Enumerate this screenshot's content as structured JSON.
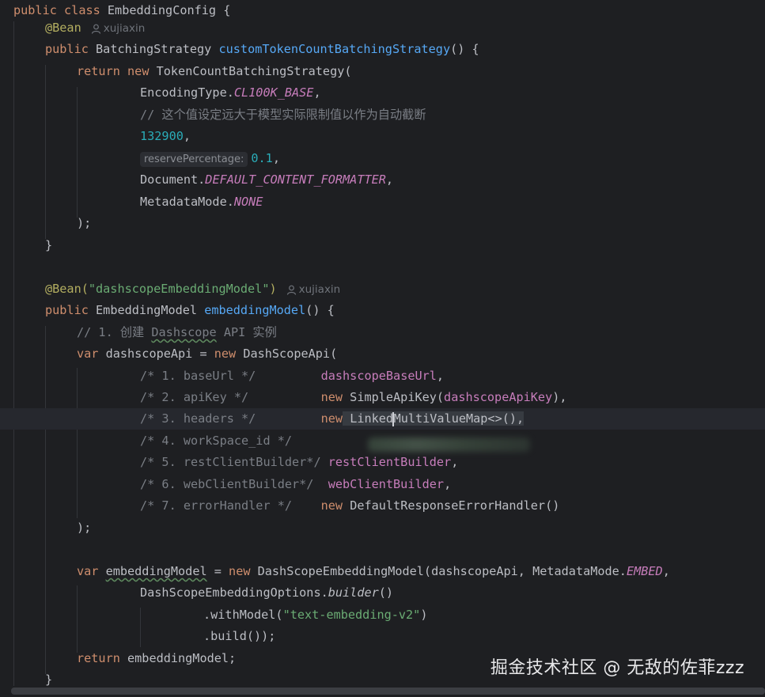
{
  "code": {
    "class_decl": {
      "kw_public": "public",
      "kw_class": "class",
      "name": "EmbeddingConfig",
      "brace": " {"
    },
    "bean1": {
      "annotation": "@Bean",
      "author": "xujiaxin"
    },
    "method1": {
      "kw_public": "public",
      "ret_type": "BatchingStrategy",
      "name": "customTokenCountBatchingStrategy",
      "tail": "() {",
      "kw_return": "return",
      "kw_new": "new",
      "ctor": "TokenCountBatchingStrategy(",
      "arg1_type": "EncodingType.",
      "arg1_const": "CL100K_BASE",
      "arg1_tail": ",",
      "comment": "// 这个值设定远大于模型实际限制值以作为自动截断",
      "arg2_num": "132900",
      "arg2_tail": ",",
      "hint_label": "reservePercentage:",
      "arg3_num": "0.1",
      "arg3_tail": ",",
      "arg4_type": "Document.",
      "arg4_const": "DEFAULT_CONTENT_FORMATTER",
      "arg4_tail": ",",
      "arg5_type": "MetadataMode.",
      "arg5_const": "NONE",
      "close_paren": ");",
      "close_brace": "}"
    },
    "bean2": {
      "annotation": "@Bean(",
      "value": "\"dashscopeEmbeddingModel\"",
      "annotation_tail": ")",
      "author": "xujiaxin"
    },
    "method2": {
      "kw_public": "public",
      "ret_type": "EmbeddingModel",
      "name": "embeddingModel",
      "tail": "() {",
      "comment_pre": "// 1. 创建 ",
      "comment_typo": "Dashscope",
      "comment_post": " API 实例",
      "kw_var": "var",
      "api_var": "dashscopeApi = ",
      "kw_new": "new",
      "api_ctor": "DashScopeApi(",
      "args": [
        {
          "comment": "/* 1. baseUrl */",
          "pad": "         ",
          "kw": "",
          "value": "",
          "field": "dashscopeBaseUrl",
          "tail": ","
        },
        {
          "comment": "/* 2. apiKey */",
          "pad": "          ",
          "kw": "new",
          "value": " SimpleApiKey(",
          "field": "dashscopeApiKey",
          "tail": "),"
        },
        {
          "comment": "/* 3. headers */",
          "pad": "         ",
          "kw": "new",
          "value": " LinkedMultiValueMap<>(),",
          "field": "",
          "tail": ""
        },
        {
          "comment": "/* 4. workSpace_id */",
          "pad": "",
          "kw": "",
          "value": "",
          "field": "",
          "tail": ""
        },
        {
          "comment": "/* 5. restClientBuilder*/",
          "pad": " ",
          "kw": "",
          "value": "",
          "field": "restClientBuilder",
          "tail": ","
        },
        {
          "comment": "/* 6. webClientBuilder*/",
          "pad": "  ",
          "kw": "",
          "value": "",
          "field": "webClientBuilder",
          "tail": ","
        },
        {
          "comment": "/* 7. errorHandler */",
          "pad": "    ",
          "kw": "new",
          "value": " DefaultResponseErrorHandler()",
          "field": "",
          "tail": ""
        }
      ],
      "api_close": ");",
      "model_var": "embeddingModel",
      "model_assign": " = ",
      "model_ctor": " DashScopeEmbeddingModel(dashscopeApi, MetadataMode.",
      "model_const": "EMBED",
      "model_tail": ",",
      "opts_type": "DashScopeEmbeddingOptions.",
      "opts_builder": "builder",
      "opts_tail": "()",
      "with_model_pre": ".withModel(",
      "with_model_str": "\"text-embedding-v2\"",
      "with_model_post": ")",
      "build": ".build());",
      "kw_return": "return",
      "return_val": " embeddingModel;",
      "close_brace": "}"
    }
  },
  "watermark": "掘金技术社区 @ 无敌的佐菲zzz",
  "colors": {
    "background": "#1e1f22",
    "keyword": "#cf8e6d",
    "annotation": "#b3ae60",
    "function": "#56a8f5",
    "string": "#6aab73",
    "number": "#2aacb8",
    "comment": "#7a7e85",
    "constant": "#c77dbb"
  }
}
